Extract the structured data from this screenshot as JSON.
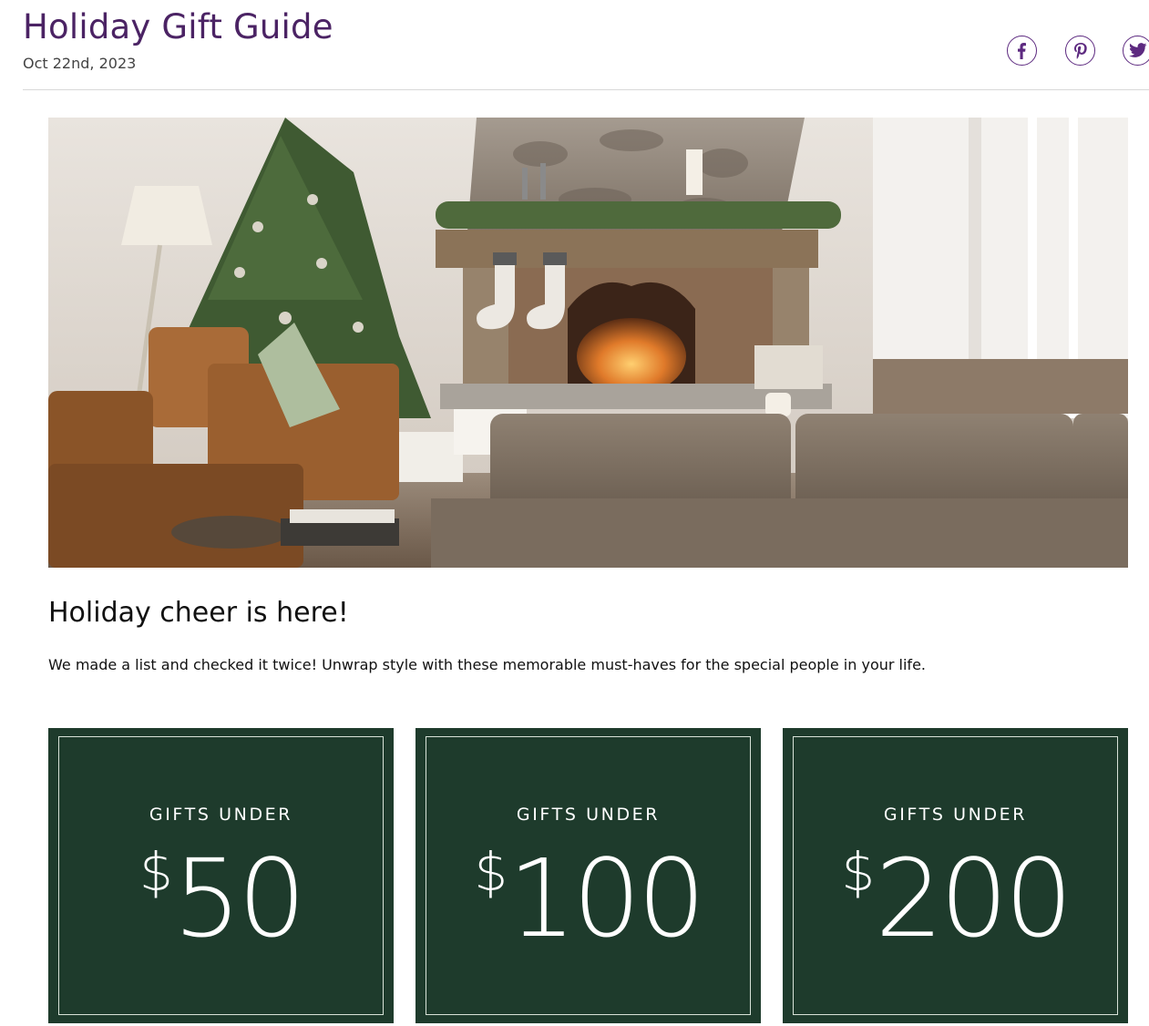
{
  "page": {
    "title": "Holiday Gift Guide",
    "date": "Oct 22nd, 2023"
  },
  "share": [
    {
      "icon": "facebook-icon"
    },
    {
      "icon": "pinterest-icon"
    },
    {
      "icon": "twitter-icon"
    }
  ],
  "colors": {
    "title": "#4b2364",
    "share_icon": "#5d2a80",
    "card_bg": "#1e3b2c"
  },
  "content": {
    "heading": "Holiday cheer is here!",
    "intro": "We made a list and checked it twice! Unwrap style with these memorable must-haves for the special people in your life."
  },
  "cards": [
    {
      "kicker": "GIFTS UNDER",
      "currency": "$",
      "amount": "50"
    },
    {
      "kicker": "GIFTS UNDER",
      "currency": "$",
      "amount": "100"
    },
    {
      "kicker": "GIFTS UNDER",
      "currency": "$",
      "amount": "200"
    }
  ]
}
